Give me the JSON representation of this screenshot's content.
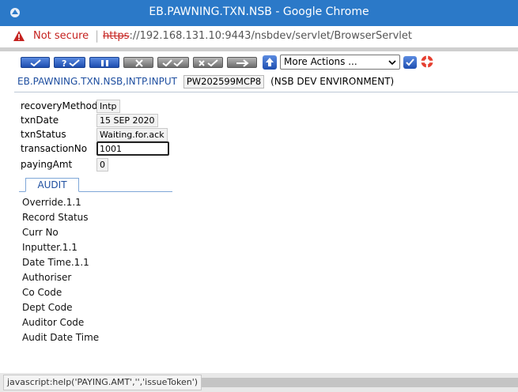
{
  "window": {
    "title": "EB.PAWNING.TXN.NSB - Google Chrome"
  },
  "address": {
    "security_label": "Not secure",
    "url_scheme": "https",
    "url_rest": "://192.168.131.10:9443/nsbdev/servlet/BrowserServlet"
  },
  "toolbar": {
    "buttons": [
      "commit-icon",
      "validate-icon",
      "hold-icon",
      "delete-icon",
      "authorise-icon",
      "reverse-icon",
      "next-icon"
    ],
    "more_actions": "More Actions ..."
  },
  "app": {
    "name": "EB.PAWNING.TXN.NSB,INTP.INPUT",
    "record_id": "PW202599MCP8",
    "environment": "(NSB DEV ENVIRONMENT)"
  },
  "form": {
    "recoveryMethod": {
      "label": "recoveryMethod",
      "value": "Intp"
    },
    "txnDate": {
      "label": "txnDate",
      "value": "15 SEP 2020"
    },
    "txnStatus": {
      "label": "txnStatus",
      "value": "Waiting.for.ack"
    },
    "transactionNo": {
      "label": "transactionNo",
      "value": "1001"
    },
    "payingAmt": {
      "label": "payingAmt",
      "value": "0"
    }
  },
  "audit": {
    "tab_label": "AUDIT",
    "fields": [
      "Override.1.1",
      "Record Status",
      "Curr No",
      "Inputter.1.1",
      "Date Time.1.1",
      "Authoriser",
      "Co Code",
      "Dept Code",
      "Auditor Code",
      "Audit Date Time"
    ]
  },
  "status": {
    "text": "javascript:help('PAYING.AMT','','issueToken')"
  },
  "colors": {
    "titlebar": "#2b79c8",
    "link_blue": "#1f4fa0",
    "warning_red": "#c5221f"
  }
}
